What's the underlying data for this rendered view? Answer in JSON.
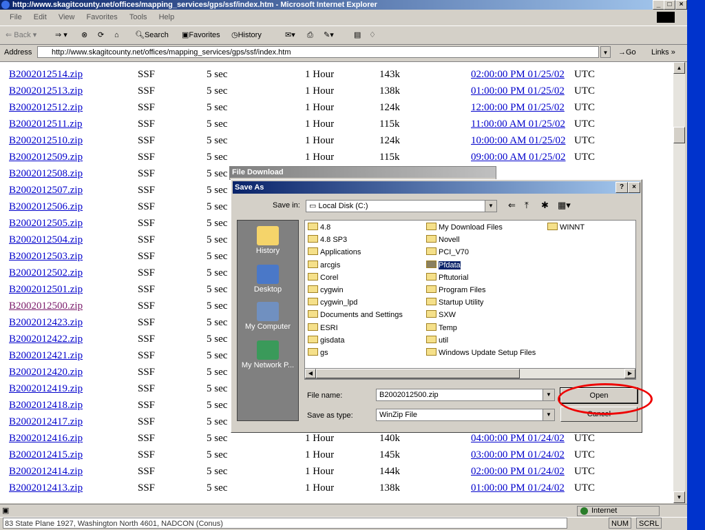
{
  "browser": {
    "title": "http://www.skagitcounty.net/offices/mapping_services/gps/ssf/index.htm - Microsoft Internet Explorer",
    "menu": [
      "File",
      "Edit",
      "View",
      "Favorites",
      "Tools",
      "Help"
    ],
    "toolbar": {
      "back": "Back",
      "search": "Search",
      "favorites": "Favorites",
      "history": "History"
    },
    "address_label": "Address",
    "address": "http://www.skagitcounty.net/offices/mapping_services/gps/ssf/index.htm",
    "go": "Go",
    "links": "Links »",
    "status_zone": "Internet",
    "bottom_text": "83 State Plane 1927, Washington North 4601, NADCON (Conus)",
    "bottom_panels": [
      "NUM",
      "SCRL"
    ]
  },
  "table": {
    "rows": [
      {
        "file": "B2002012514.zip",
        "type": "SSF",
        "sample": "5 sec",
        "dur": "1 Hour",
        "size": "143k",
        "time": "02:00:00 PM 01/25/02",
        "tz": "UTC"
      },
      {
        "file": "B2002012513.zip",
        "type": "SSF",
        "sample": "5 sec",
        "dur": "1 Hour",
        "size": "138k",
        "time": "01:00:00 PM 01/25/02",
        "tz": "UTC"
      },
      {
        "file": "B2002012512.zip",
        "type": "SSF",
        "sample": "5 sec",
        "dur": "1 Hour",
        "size": "124k",
        "time": "12:00:00 PM 01/25/02",
        "tz": "UTC"
      },
      {
        "file": "B2002012511.zip",
        "type": "SSF",
        "sample": "5 sec",
        "dur": "1 Hour",
        "size": "115k",
        "time": "11:00:00 AM 01/25/02",
        "tz": "UTC"
      },
      {
        "file": "B2002012510.zip",
        "type": "SSF",
        "sample": "5 sec",
        "dur": "1 Hour",
        "size": "124k",
        "time": "10:00:00 AM 01/25/02",
        "tz": "UTC"
      },
      {
        "file": "B2002012509.zip",
        "type": "SSF",
        "sample": "5 sec",
        "dur": "1 Hour",
        "size": "115k",
        "time": "09:00:00 AM 01/25/02",
        "tz": "UTC"
      },
      {
        "file": "B2002012508.zip",
        "type": "SSF",
        "sample": "5 sec",
        "dur": "",
        "size": "",
        "time": "",
        "tz": ""
      },
      {
        "file": "B2002012507.zip",
        "type": "SSF",
        "sample": "5 sec",
        "dur": "",
        "size": "",
        "time": "",
        "tz": ""
      },
      {
        "file": "B2002012506.zip",
        "type": "SSF",
        "sample": "5 sec",
        "dur": "",
        "size": "",
        "time": "",
        "tz": ""
      },
      {
        "file": "B2002012505.zip",
        "type": "SSF",
        "sample": "5 sec",
        "dur": "",
        "size": "",
        "time": "",
        "tz": ""
      },
      {
        "file": "B2002012504.zip",
        "type": "SSF",
        "sample": "5 sec",
        "dur": "",
        "size": "",
        "time": "",
        "tz": ""
      },
      {
        "file": "B2002012503.zip",
        "type": "SSF",
        "sample": "5 sec",
        "dur": "",
        "size": "",
        "time": "",
        "tz": ""
      },
      {
        "file": "B2002012502.zip",
        "type": "SSF",
        "sample": "5 sec",
        "dur": "",
        "size": "",
        "time": "",
        "tz": ""
      },
      {
        "file": "B2002012501.zip",
        "type": "SSF",
        "sample": "5 sec",
        "dur": "",
        "size": "",
        "time": "",
        "tz": ""
      },
      {
        "file": "B2002012500.zip",
        "type": "SSF",
        "sample": "5 sec",
        "dur": "",
        "size": "",
        "time": "",
        "tz": "",
        "visited": true
      },
      {
        "file": "B2002012423.zip",
        "type": "SSF",
        "sample": "5 sec",
        "dur": "",
        "size": "",
        "time": "",
        "tz": ""
      },
      {
        "file": "B2002012422.zip",
        "type": "SSF",
        "sample": "5 sec",
        "dur": "",
        "size": "",
        "time": "",
        "tz": ""
      },
      {
        "file": "B2002012421.zip",
        "type": "SSF",
        "sample": "5 sec",
        "dur": "",
        "size": "",
        "time": "",
        "tz": ""
      },
      {
        "file": "B2002012420.zip",
        "type": "SSF",
        "sample": "5 sec",
        "dur": "",
        "size": "",
        "time": "",
        "tz": ""
      },
      {
        "file": "B2002012419.zip",
        "type": "SSF",
        "sample": "5 sec",
        "dur": "",
        "size": "",
        "time": "",
        "tz": ""
      },
      {
        "file": "B2002012418.zip",
        "type": "SSF",
        "sample": "5 sec",
        "dur": "",
        "size": "",
        "time": "",
        "tz": ""
      },
      {
        "file": "B2002012417.zip",
        "type": "SSF",
        "sample": "5 sec",
        "dur": "",
        "size": "",
        "time": "",
        "tz": ""
      },
      {
        "file": "B2002012416.zip",
        "type": "SSF",
        "sample": "5 sec",
        "dur": "1 Hour",
        "size": "140k",
        "time": "04:00:00 PM 01/24/02",
        "tz": "UTC"
      },
      {
        "file": "B2002012415.zip",
        "type": "SSF",
        "sample": "5 sec",
        "dur": "1 Hour",
        "size": "145k",
        "time": "03:00:00 PM 01/24/02",
        "tz": "UTC"
      },
      {
        "file": "B2002012414.zip",
        "type": "SSF",
        "sample": "5 sec",
        "dur": "1 Hour",
        "size": "144k",
        "time": "02:00:00 PM 01/24/02",
        "tz": "UTC"
      },
      {
        "file": "B2002012413.zip",
        "type": "SSF",
        "sample": "5 sec",
        "dur": "1 Hour",
        "size": "138k",
        "time": "01:00:00 PM 01/24/02",
        "tz": "UTC"
      }
    ]
  },
  "file_download": {
    "title": "File Download"
  },
  "dialog": {
    "title": "Save As",
    "save_in_label": "Save in:",
    "save_in_value": "Local Disk (C:)",
    "places": [
      "History",
      "Desktop",
      "My Computer",
      "My Network P..."
    ],
    "folders_col1": [
      "4.8",
      "4.8 SP3",
      "Applications",
      "arcgis",
      "Corel",
      "cygwin",
      "cygwin_lpd",
      "Documents and Settings",
      "ESRI",
      "gisdata",
      "gs"
    ],
    "folders_col2": [
      "My Download Files",
      "Novell",
      "PCI_V70",
      "Pfdata",
      "Pftutorial",
      "Program Files",
      "Startup Utility",
      "SXW",
      "Temp",
      "util",
      "Windows Update Setup Files"
    ],
    "folders_col3": [
      "WINNT"
    ],
    "selected_folder": "Pfdata",
    "file_name_label": "File name:",
    "file_name": "B2002012500.zip",
    "save_type_label": "Save as type:",
    "save_type": "WinZip File",
    "open_button": "Open",
    "cancel_button": "Cancel"
  }
}
